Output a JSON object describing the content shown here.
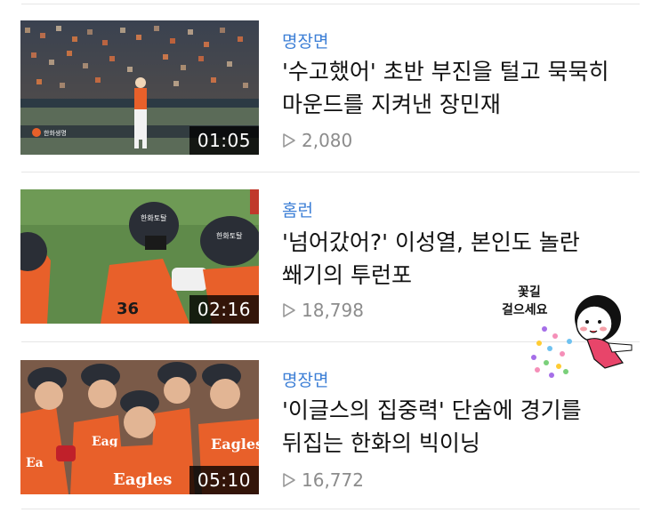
{
  "videos": [
    {
      "category": "명장면",
      "title": "'수고했어' 초반 부진을 털고 묵묵히 마운드를 지켜낸 장민재",
      "duration": "01:05",
      "views": "2,080",
      "icon": "play-outline-icon"
    },
    {
      "category": "홈런",
      "title": "'넘어갔어?' 이성열, 본인도 놀란 쐐기의 투런포",
      "duration": "02:16",
      "views": "18,798",
      "icon": "play-outline-icon"
    },
    {
      "category": "명장면",
      "title": "'이글스의 집중력' 단숨에 경기를 뒤집는 한화의 빅이닝",
      "duration": "05:10",
      "views": "16,772",
      "icon": "play-outline-icon"
    }
  ],
  "sticker": {
    "line1": "꽃길",
    "line2": "걸으세요"
  },
  "colors": {
    "category": "#3d7fd6",
    "title": "#111111",
    "views": "#8c8c8c",
    "jersey_orange": "#e8602a"
  }
}
